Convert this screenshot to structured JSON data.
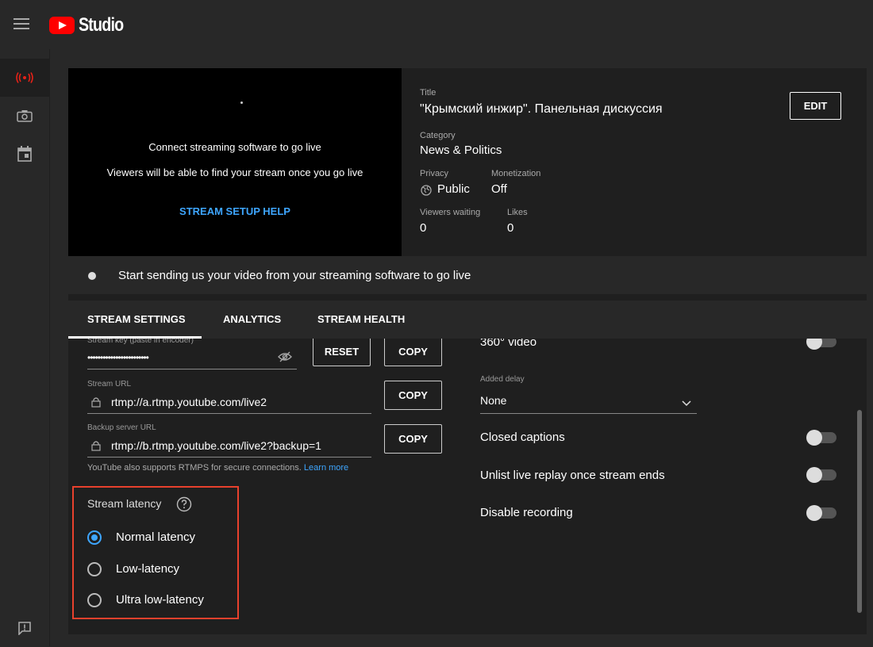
{
  "app": {
    "name": "Studio"
  },
  "preview": {
    "message1": "Connect streaming software to go live",
    "message2": "Viewers will be able to find your stream once you go live",
    "help_link": "STREAM SETUP HELP"
  },
  "info": {
    "title_label": "Title",
    "title": "\"Крымский инжир\". Панельная дискуссия",
    "category_label": "Category",
    "category": "News & Politics",
    "privacy_label": "Privacy",
    "privacy": "Public",
    "monetization_label": "Monetization",
    "monetization": "Off",
    "viewers_label": "Viewers waiting",
    "viewers": "0",
    "likes_label": "Likes",
    "likes": "0",
    "edit_label": "EDIT"
  },
  "status": {
    "text": "Start sending us your video from your streaming software to go live"
  },
  "tabs": [
    {
      "label": "STREAM SETTINGS",
      "active": true
    },
    {
      "label": "ANALYTICS",
      "active": false
    },
    {
      "label": "STREAM HEALTH",
      "active": false
    }
  ],
  "stream_key": {
    "label": "Stream key (paste in encoder)",
    "value": "••••••••••••••••••••••••",
    "reset_label": "RESET",
    "copy_label": "COPY"
  },
  "stream_url": {
    "label": "Stream URL",
    "value": "rtmp://a.rtmp.youtube.com/live2",
    "copy_label": "COPY"
  },
  "backup_url": {
    "label": "Backup server URL",
    "value": "rtmp://b.rtmp.youtube.com/live2?backup=1",
    "copy_label": "COPY"
  },
  "rtmps_note": {
    "text": "YouTube also supports RTMPS for secure connections.",
    "link": "Learn more"
  },
  "latency": {
    "title": "Stream latency",
    "options": [
      {
        "label": "Normal latency",
        "selected": true
      },
      {
        "label": "Low-latency",
        "selected": false
      },
      {
        "label": "Ultra low-latency",
        "selected": false
      }
    ]
  },
  "right_settings": {
    "video_360": {
      "label": "360° video",
      "enabled": false
    },
    "added_delay": {
      "label": "Added delay",
      "value": "None"
    },
    "closed_captions": {
      "label": "Closed captions",
      "enabled": false
    },
    "unlist_replay": {
      "label": "Unlist live replay once stream ends",
      "enabled": false
    },
    "disable_recording": {
      "label": "Disable recording",
      "enabled": false
    }
  },
  "colors": {
    "brand_red": "#ff0000",
    "link_blue": "#3ea6ff",
    "highlight_border": "#e8412d"
  }
}
